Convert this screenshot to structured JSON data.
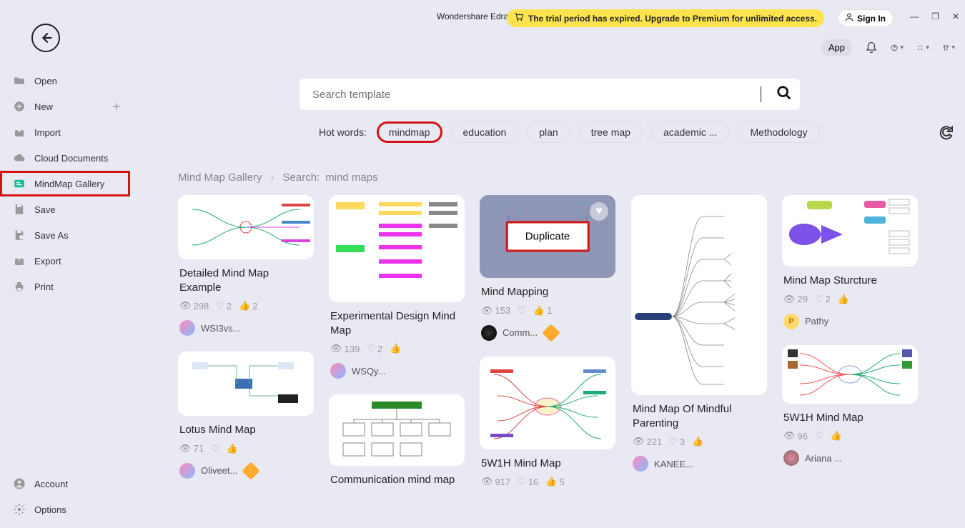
{
  "brand": "Wondershare EdrawM",
  "trial_banner": "The trial period has expired. Upgrade to Premium for unlimited access.",
  "signin": "Sign In",
  "toolbar": {
    "app_badge": "App"
  },
  "sidebar": {
    "items": [
      {
        "label": "Open"
      },
      {
        "label": "New"
      },
      {
        "label": "Import"
      },
      {
        "label": "Cloud Documents"
      },
      {
        "label": "MindMap Gallery"
      },
      {
        "label": "Save"
      },
      {
        "label": "Save As"
      },
      {
        "label": "Export"
      },
      {
        "label": "Print"
      }
    ],
    "bottom": [
      {
        "label": "Account"
      },
      {
        "label": "Options"
      }
    ]
  },
  "search_placeholder": "Search template",
  "hotwords_label": "Hot words:",
  "hotwords": [
    "mindmap",
    "education",
    "plan",
    "tree map",
    "academic ...",
    "Methodology"
  ],
  "breadcrumb": {
    "root": "Mind Map Gallery",
    "search_prefix": "Search:",
    "query": "mind maps"
  },
  "duplicate_label": "Duplicate",
  "cards": {
    "detailed": {
      "title": "Detailed Mind Map Example",
      "views": "298",
      "hearts": "2",
      "likes": "2",
      "author": "WSI3vs..."
    },
    "lotus": {
      "title": "Lotus Mind Map",
      "views": "71",
      "author": "Oliveet..."
    },
    "experimental": {
      "title": "Experimental Design Mind Map",
      "views": "139",
      "hearts": "2",
      "author": "WSQy..."
    },
    "comm": {
      "title": "Communication mind map"
    },
    "mindmapping": {
      "title": "Mind Mapping",
      "views": "153",
      "likes": "1",
      "author": "Comm..."
    },
    "fivew": {
      "title": "5W1H Mind Map",
      "views": "917",
      "hearts": "16",
      "likes": "5"
    },
    "mindful": {
      "title": "Mind Map Of Mindful Parenting",
      "views": "221",
      "hearts": "3",
      "author": "KANEE..."
    },
    "structure": {
      "title": "Mind Map Sturcture",
      "views": "29",
      "hearts": "2",
      "author": "Pathy"
    },
    "fivew2": {
      "title": "5W1H Mind Map",
      "views": "96",
      "author": "Ariana ..."
    }
  }
}
